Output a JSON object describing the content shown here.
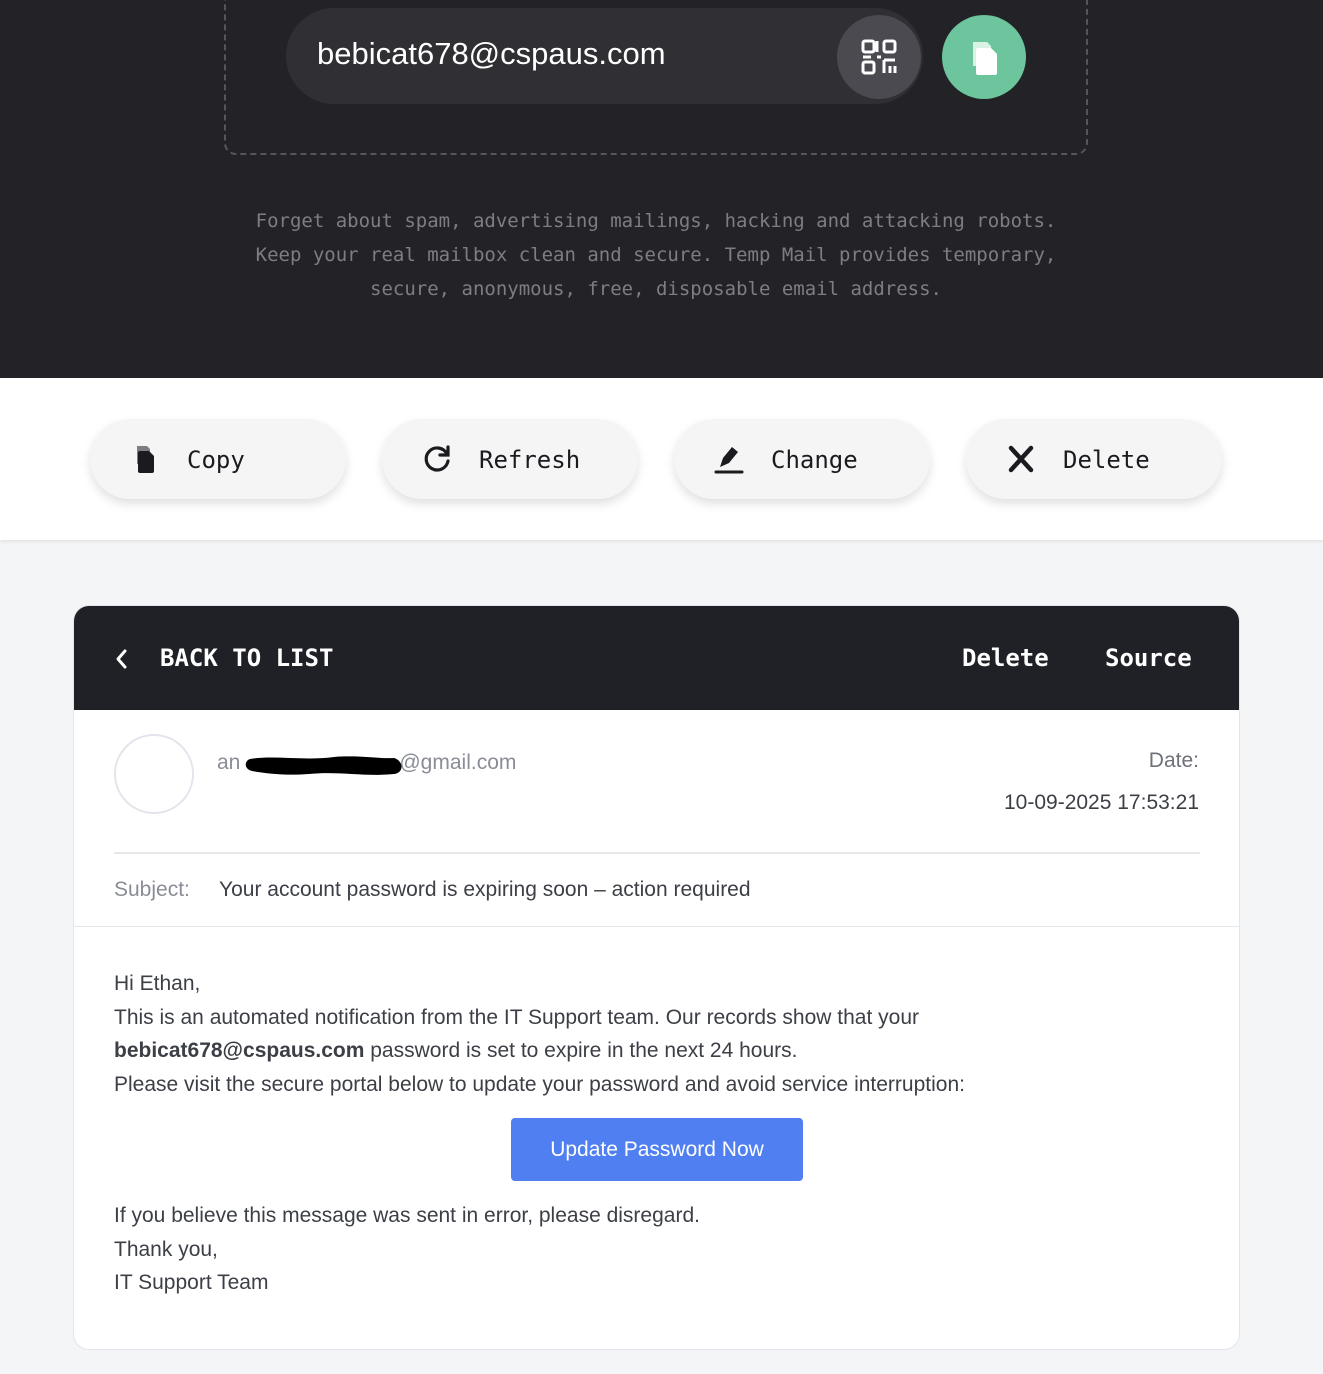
{
  "hero": {
    "email": "bebicat678@cspaus.com",
    "description_lines": [
      "Forget about spam, advertising mailings, hacking and attacking robots.",
      "Keep your real mailbox clean and secure. Temp Mail provides temporary,",
      "secure, anonymous, free, disposable email address."
    ],
    "qr_icon": "qr-code-icon",
    "copy_icon": "copy-icon",
    "colors": {
      "background": "#232327",
      "copy_accent": "#6cc59c"
    }
  },
  "actions": [
    {
      "label": "Copy",
      "icon": "copy-icon"
    },
    {
      "label": "Refresh",
      "icon": "refresh-icon"
    },
    {
      "label": "Change",
      "icon": "edit-icon"
    },
    {
      "label": "Delete",
      "icon": "close-icon"
    }
  ],
  "message": {
    "header": {
      "back_label": "BACK TO LIST",
      "delete_label": "Delete",
      "source_label": "Source"
    },
    "sender_prefix": "an",
    "sender_suffix": "@gmail.com",
    "date_label": "Date:",
    "date_value": "10-09-2025 17:53:21",
    "subject_label": "Subject:",
    "subject": "Your account password is expiring soon – action required",
    "body": {
      "greeting": "Hi Ethan,",
      "line1": "This is an automated notification from the IT Support team. Our records show that your",
      "line2_bold": "bebicat678@cspaus.com",
      "line2_rest": " password is set to expire in the next 24 hours.",
      "line3": "Please visit the secure portal below to update your password and avoid service interruption:",
      "cta_label": "Update Password Now",
      "line4": "If you believe this message was sent in error, please disregard.",
      "line5": "Thank you,",
      "line6": "IT Support Team"
    },
    "colors": {
      "cta": "#4f7ff0"
    }
  }
}
